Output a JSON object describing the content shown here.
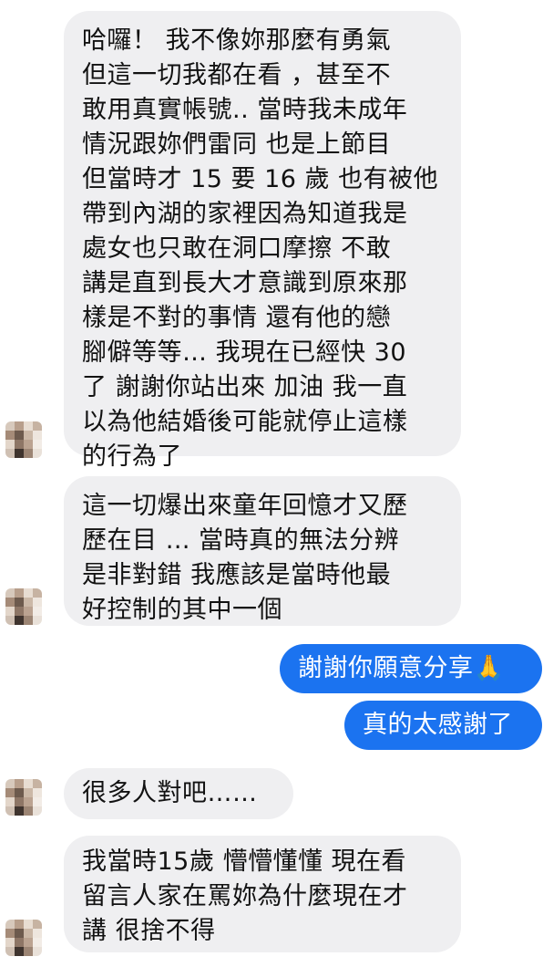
{
  "conversation": {
    "messages": [
      {
        "id": "m1",
        "sender": "other",
        "text": "哈囉！ 我不像妳那麼有勇氣\n但這一切我都在看 ，甚至不\n敢用真實帳號.. 當時我未成年\n情況跟妳們雷同 也是上節目\n但當時才 15 要 16 歲 也有被他\n帶到內湖的家裡因為知道我是\n處女也只敢在洞口摩擦 不敢\n講是直到長大才意識到原來那\n樣是不對的事情 還有他的戀\n腳僻等等… 我現在已經快 30\n了 謝謝你站出來 加油 我一直\n以為他結婚後可能就停止這樣\n的行為了"
      },
      {
        "id": "m2",
        "sender": "other",
        "text": "這一切爆出來童年回憶才又歷\n歷在目 … 當時真的無法分辨\n是非對錯 我應該是當時他最\n好控制的其中一個"
      },
      {
        "id": "m3",
        "sender": "me",
        "text": "謝謝你願意分享🙏"
      },
      {
        "id": "m4",
        "sender": "me",
        "text": "真的太感謝了"
      },
      {
        "id": "m5",
        "sender": "other",
        "text": "很多人對吧……"
      },
      {
        "id": "m6",
        "sender": "other",
        "text": "我當時15歲 懵懵懂懂 現在看\n留言人家在罵妳為什麼現在才\n講 很捨不得"
      }
    ]
  },
  "avatar": {
    "description_icon": "pixelated-avatar-icon",
    "pixel_colors": [
      "#d7c9bc",
      "#b89f8c",
      "#e8ddd2",
      "#c7b3a2",
      "#a58b78",
      "#6d5a4d",
      "#cbb8a7",
      "#eee6de",
      "#e3d6ca",
      "#8e7666",
      "#bba391",
      "#f2ece6",
      "#cfc0b3",
      "#3f342e",
      "#9c8574",
      "#e9e1d9"
    ]
  }
}
